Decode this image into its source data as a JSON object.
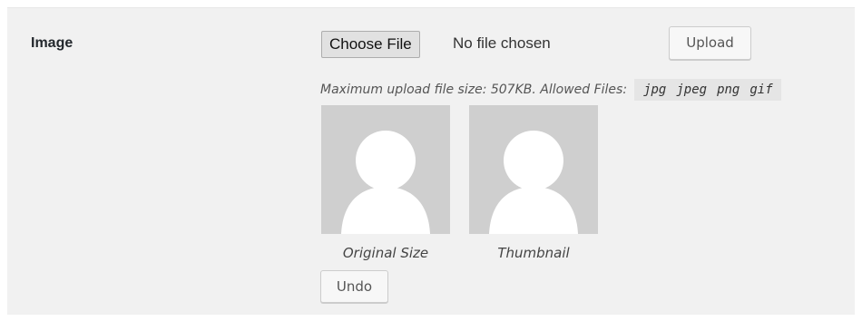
{
  "field": {
    "label": "Image"
  },
  "file_input": {
    "button_label": "Choose File",
    "status": "No file chosen"
  },
  "upload_button": {
    "label": "Upload"
  },
  "note": {
    "prefix": "Maximum upload file size: 507KB. Allowed Files:",
    "allowed_files": [
      "jpg",
      "jpeg",
      "png",
      "gif"
    ]
  },
  "previews": [
    {
      "caption": "Original Size",
      "icon": "default-avatar-icon"
    },
    {
      "caption": "Thumbnail",
      "icon": "default-avatar-icon"
    }
  ],
  "undo_button": {
    "label": "Undo"
  },
  "colors": {
    "panel_bg": "#f1f1f1",
    "avatar_bg": "#cfcfcf",
    "avatar_fg": "#ffffff"
  }
}
